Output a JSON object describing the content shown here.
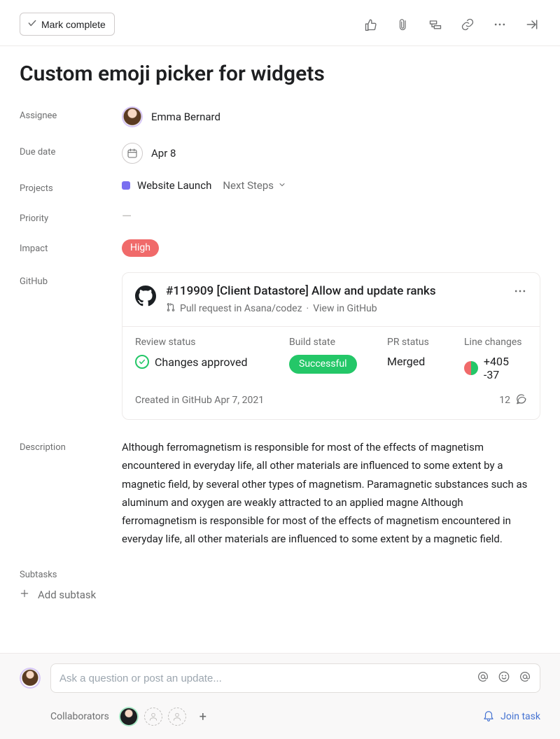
{
  "toolbar": {
    "mark_complete": "Mark complete"
  },
  "task": {
    "title": "Custom emoji picker for widgets"
  },
  "labels": {
    "assignee": "Assignee",
    "due_date": "Due date",
    "projects": "Projects",
    "priority": "Priority",
    "impact": "Impact",
    "github": "GitHub",
    "description": "Description",
    "subtasks": "Subtasks",
    "add_subtask": "Add subtask",
    "collaborators": "Collaborators",
    "join_task": "Join task"
  },
  "fields": {
    "assignee_name": "Emma Bernard",
    "due_date": "Apr 8",
    "project_name": "Website Launch",
    "project_section": "Next Steps",
    "priority": "—",
    "impact": "High"
  },
  "github": {
    "title": "#119909 [Client Datastore] Allow and update ranks",
    "subtitle_repo": "Pull request in Asana/codez",
    "subtitle_link": "View in GitHub",
    "review_status_label": "Review status",
    "review_status_value": "Changes approved",
    "build_state_label": "Build state",
    "build_state_value": "Successful",
    "pr_status_label": "PR status",
    "pr_status_value": "Merged",
    "line_changes_label": "Line changes",
    "line_changes_value": "+405 -37",
    "created": "Created in GitHub Apr 7, 2021",
    "comment_count": "12"
  },
  "description": "Although ferromagnetism is responsible for most of the effects of magnetism encountered in everyday life, all other materials are influenced to some extent by a magnetic field, by several other types of magnetism. Paramagnetic substances such as aluminum and oxygen are weakly attracted to an applied magne Although ferromagnetism is responsible for most of the effects of magnetism encountered in everyday life, all other materials are influenced to some extent by a magnetic field.",
  "compose": {
    "placeholder": "Ask a question or post an update..."
  }
}
